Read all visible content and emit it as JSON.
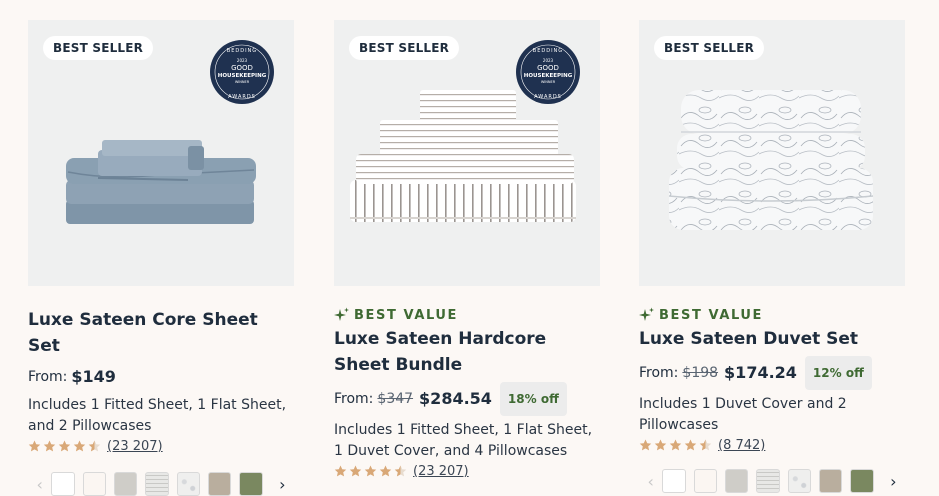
{
  "products": [
    {
      "badge": "BEST SELLER",
      "award": {
        "line1": "BEDDING",
        "line2": "2023",
        "line3": "GOOD",
        "line4": "HOUSEKEEPING",
        "line5": "WINNER",
        "line6": "AWARDS"
      },
      "title": "Luxe Sateen Core Sheet Set",
      "from_label": "From:",
      "price": "$149",
      "description": "Includes 1 Fitted Sheet, 1 Flat Sheet, and 2 Pillowcases",
      "rating": 4.5,
      "review_count": "(23 207)",
      "swatches": [
        "#ffffff",
        "#fbf6f2",
        "#cfcdc8",
        "stripe",
        "pattern",
        "#b9ae9e",
        "#7a8860"
      ]
    },
    {
      "badge": "BEST SELLER",
      "award": {
        "line1": "BEDDING",
        "line2": "2023",
        "line3": "GOOD",
        "line4": "HOUSEKEEPING",
        "line5": "WINNER",
        "line6": "AWARDS"
      },
      "tag": "BEST VALUE",
      "title": "Luxe Sateen Hardcore Sheet Bundle",
      "from_label": "From:",
      "old_price": "$347",
      "price": "$284.54",
      "discount": "18% off",
      "description": "Includes 1 Fitted Sheet, 1 Flat Sheet, 1 Duvet Cover, and 4 Pillowcases",
      "rating": 4.5,
      "review_count": "(23 207)"
    },
    {
      "badge": "BEST SELLER",
      "tag": "BEST VALUE",
      "title": "Luxe Sateen Duvet Set",
      "from_label": "From:",
      "old_price": "$198",
      "price": "$174.24",
      "discount": "12% off",
      "description": "Includes 1 Duvet Cover and 2 Pillowcases",
      "rating": 4.5,
      "review_count": "(8 742)",
      "swatches": [
        "#ffffff",
        "#fbf6f2",
        "#cfcdc8",
        "stripe",
        "pattern",
        "#b9ae9e",
        "#7a8860"
      ]
    }
  ],
  "colors": {
    "star": "#d9a877",
    "accent_green": "#3f6a33",
    "navy": "#1f3150"
  }
}
